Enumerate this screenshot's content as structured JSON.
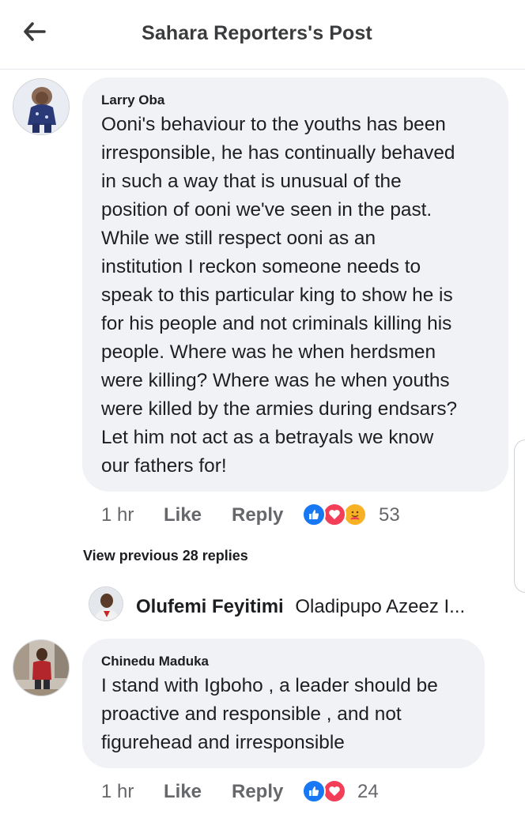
{
  "header": {
    "title": "Sahara Reporters's Post"
  },
  "comments": [
    {
      "author": "Larry Oba",
      "lines": [
        "Ooni's behaviour to the youths has been",
        "irresponsible, he has continually behaved",
        "in such a way that is unusual of the",
        "position of ooni we've seen in the past.",
        "While we still respect ooni as an",
        "institution I reckon someone needs to",
        "speak to this particular king to show he is",
        "for his people and not criminals killing his",
        "people. Where was he when herdsmen",
        "were killing? Where was he when youths",
        "were killed by the armies during endsars?",
        "Let him not act as a betrayals we know",
        "our fathers for!"
      ],
      "time": "1 hr",
      "like_label": "Like",
      "reply_label": "Reply",
      "reaction_count": "53",
      "reactions": [
        "like",
        "love",
        "care"
      ]
    },
    {
      "author": "Chinedu Maduka",
      "lines": [
        "I stand with Igboho , a leader should be",
        "proactive and responsible , and not",
        "figurehead and irresponsible"
      ],
      "time": "1 hr",
      "like_label": "Like",
      "reply_label": "Reply",
      "reaction_count": "24",
      "reactions": [
        "like",
        "love"
      ]
    }
  ],
  "replies": {
    "view_previous": "View previous 28 replies",
    "preview_name": "Olufemi Feyitimi",
    "preview_snippet": "Oladipupo Azeez I..."
  },
  "colors": {
    "bubble": "#f0f2f5",
    "like_blue": "#1877f2",
    "love_red": "#f33e58",
    "care_yellow": "#f7b125",
    "meta_gray": "#65676b"
  },
  "icons": {
    "back": "arrow-left-icon",
    "like_reaction": "thumbs-up-icon",
    "love_reaction": "heart-icon",
    "care_reaction": "care-hug-icon"
  }
}
